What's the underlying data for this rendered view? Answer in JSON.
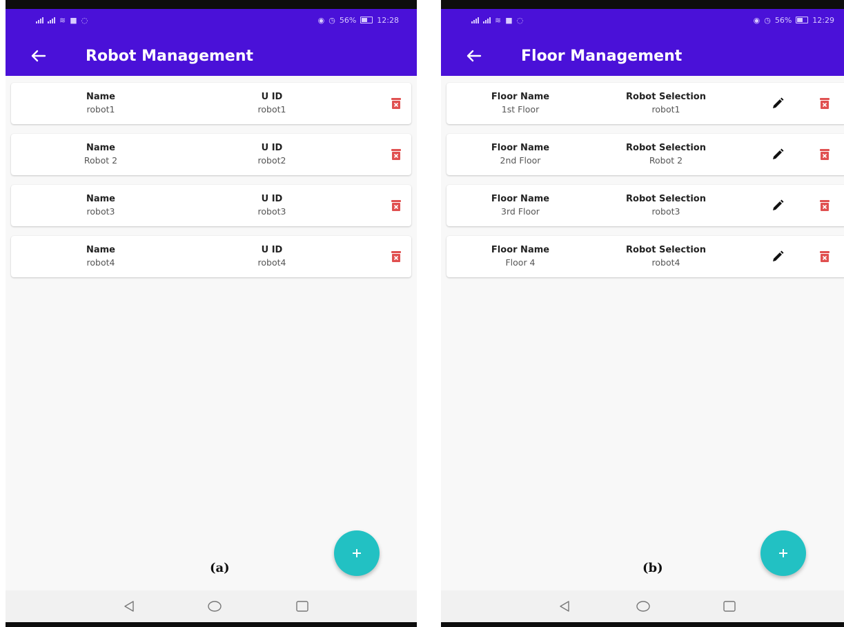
{
  "colors": {
    "appbar": "#4a11d8",
    "fab": "#22c1c3",
    "delete_icon": "#e05050",
    "edit_icon": "#111111"
  },
  "panel_a": {
    "status": {
      "battery": "56%",
      "time": "12:28"
    },
    "title": "Robot Management",
    "col1_header": "Name",
    "col2_header": "U ID",
    "rows": [
      {
        "col1": "robot1",
        "col2": "robot1"
      },
      {
        "col1": "Robot 2",
        "col2": "robot2"
      },
      {
        "col1": "robot3",
        "col2": "robot3"
      },
      {
        "col1": "robot4",
        "col2": "robot4"
      }
    ],
    "fab_icon": "plus-icon",
    "caption": "(a)"
  },
  "panel_b": {
    "status": {
      "battery": "56%",
      "time": "12:29"
    },
    "title": "Floor Management",
    "col1_header": "Floor Name",
    "col2_header": "Robot Selection",
    "rows": [
      {
        "col1": "1st Floor",
        "col2": "robot1"
      },
      {
        "col1": "2nd Floor",
        "col2": "Robot 2"
      },
      {
        "col1": "3rd Floor",
        "col2": "robot3"
      },
      {
        "col1": "Floor 4",
        "col2": "robot4"
      }
    ],
    "fab_icon": "plus-icon",
    "caption": "(b)"
  },
  "icons": {
    "back": "arrow-left-icon",
    "delete": "trash-icon",
    "edit": "pencil-icon",
    "nav_back": "triangle-back-icon",
    "nav_home": "circle-home-icon",
    "nav_recents": "square-recents-icon"
  }
}
